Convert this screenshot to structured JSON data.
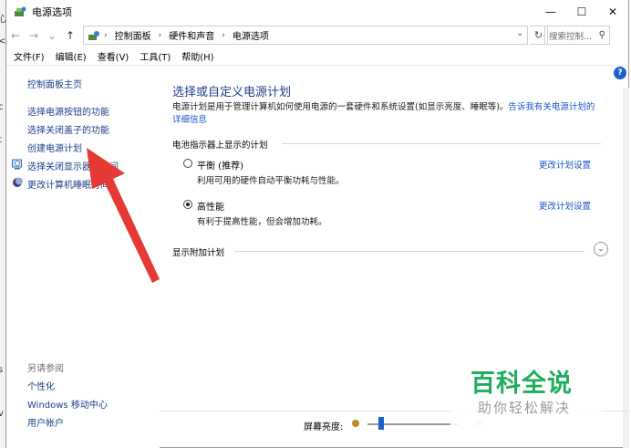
{
  "window": {
    "title": "电源选项",
    "controls": {
      "minimize": "—",
      "maximize": "☐",
      "close": "✕"
    }
  },
  "address_bar": {
    "back": "←",
    "forward": "→",
    "recent": "⌄",
    "up": "↑",
    "breadcrumbs": [
      "控制面板",
      "硬件和声音",
      "电源选项"
    ],
    "separator": "›",
    "dropdown": "⌄",
    "refresh": "↻",
    "search_placeholder": "搜索控制...",
    "search_icon": "⚲"
  },
  "menu": [
    "文件(F)",
    "编辑(E)",
    "查看(V)",
    "工具(T)",
    "帮助(H)"
  ],
  "sidebar": {
    "home": "控制面板主页",
    "links": [
      {
        "label": "选择电源按钮的功能",
        "icon": ""
      },
      {
        "label": "选择关闭盖子的功能",
        "icon": ""
      },
      {
        "label": "创建电源计划",
        "icon": ""
      },
      {
        "label": "选择关闭显示器的时间",
        "icon": "monitor-clock-icon"
      },
      {
        "label": "更改计算机睡眠时间",
        "icon": "moon-icon"
      }
    ],
    "see_also_header": "另请参阅",
    "see_also": [
      "个性化",
      "Windows 移动中心",
      "用户帐户"
    ]
  },
  "main": {
    "title": "选择或自定义电源计划",
    "description": "电源计划是用于管理计算机如何使用电源的一套硬件和系统设置(如显示亮度、睡眠等)。",
    "description_link": "告诉我有关电源计划的详细信息",
    "battery_section": "电池指示器上显示的计划",
    "plans": [
      {
        "name": "平衡 (推荐)",
        "desc": "利用可用的硬件自动平衡功耗与性能。",
        "link": "更改计划设置",
        "selected": false
      },
      {
        "name": "高性能",
        "desc": "有利于提高性能，但会增加功耗。",
        "link": "更改计划设置",
        "selected": true
      }
    ],
    "extra_plans": "显示附加计划",
    "expand_icon": "⌄",
    "help": "?"
  },
  "footer": {
    "brightness_label": "屏幕亮度:",
    "brightness_level": 0.12,
    "sun_icon": "✻"
  },
  "left_fragments": [
    "心",
    "<",
    "c",
    "t",
    "l",
    "s",
    "v"
  ],
  "watermark": {
    "main": "百科全说",
    "sub": "助你轻松解决"
  },
  "colors": {
    "link": "#1a55c6",
    "title": "#1e3f8a",
    "accent": "#1a62c9",
    "arrow": "#e53935",
    "watermark": "#1fae5e"
  }
}
